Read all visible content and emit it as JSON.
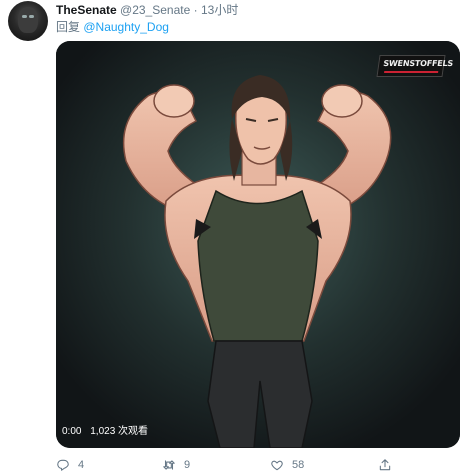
{
  "tweet": {
    "display_name": "TheSenate",
    "handle": "@23_Senate",
    "separator": "·",
    "time": "13小时",
    "reply_prefix": "回复",
    "reply_to": "@Naughty_Dog"
  },
  "video": {
    "duration": "0:00",
    "views": "1,023 次观看",
    "watermark_text": "SWENSTOFFELS"
  },
  "actions": {
    "reply_count": "4",
    "retweet_count": "9",
    "like_count": "58"
  },
  "icons": {
    "reply": "reply-icon",
    "retweet": "retweet-icon",
    "like": "like-icon",
    "share": "share-icon"
  },
  "colors": {
    "link": "#1da1f2",
    "meta": "#657786",
    "text": "#14171a"
  }
}
